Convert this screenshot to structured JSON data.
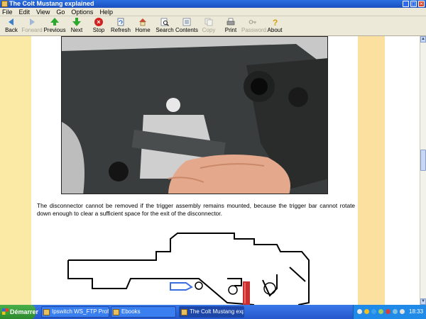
{
  "window": {
    "title": "The Colt Mustang explained"
  },
  "menu": [
    "File",
    "Edit",
    "View",
    "Go",
    "Options",
    "Help"
  ],
  "toolbar": [
    {
      "label": "Back",
      "icon": "back-arrow-icon",
      "enabled": true
    },
    {
      "label": "Forward",
      "icon": "forward-arrow-icon",
      "enabled": false
    },
    {
      "label": "Previous",
      "icon": "up-arrow-icon",
      "enabled": true
    },
    {
      "label": "Next",
      "icon": "down-arrow-icon",
      "enabled": true
    },
    {
      "label": "Stop",
      "icon": "stop-icon",
      "enabled": true
    },
    {
      "label": "Refresh",
      "icon": "refresh-icon",
      "enabled": true
    },
    {
      "label": "Home",
      "icon": "home-icon",
      "enabled": true
    },
    {
      "label": "Search",
      "icon": "search-icon",
      "enabled": true
    },
    {
      "label": "Contents",
      "icon": "contents-icon",
      "enabled": true
    },
    {
      "label": "Copy",
      "icon": "copy-icon",
      "enabled": false
    },
    {
      "label": "Print",
      "icon": "print-icon",
      "enabled": true
    },
    {
      "label": "Password",
      "icon": "password-icon",
      "enabled": false
    },
    {
      "label": "About",
      "icon": "about-icon",
      "enabled": true
    }
  ],
  "content": {
    "caption": "The disconnector cannot be removed if the trigger assembly remains mounted, because the trigger bar cannot rotate down enough to clear a sufficient space for the exit of the disconnector."
  },
  "taskbar": {
    "start": "Démarrer",
    "items": [
      {
        "label": "Ipswitch WS_FTP Profes...",
        "active": false
      },
      {
        "label": "Ebooks",
        "active": false
      },
      {
        "label": "The Colt Mustang expla...",
        "active": true
      }
    ],
    "clock": "18:33"
  },
  "colors": {
    "left_band": "#fbe9a6",
    "right_band": "#fbe0a0",
    "taskbar": "#2456cc",
    "start": "#2c8a2c",
    "highlight_red": "#c83030"
  }
}
